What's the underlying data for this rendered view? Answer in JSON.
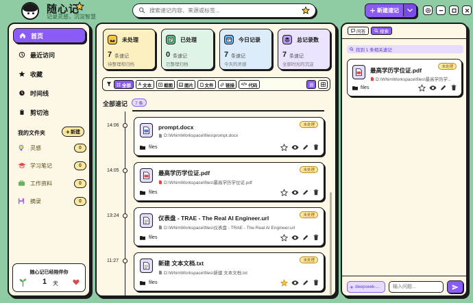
{
  "app": {
    "title": "随心记",
    "subtitle": "记录灵感，沉淀智慧"
  },
  "search": {
    "placeholder": "搜索速记内容、来源或标签..."
  },
  "toolbar": {
    "new_label": "新建速记"
  },
  "sidebar": {
    "nav": [
      {
        "label": "首页",
        "icon": "home-icon",
        "active": true
      },
      {
        "label": "最近访问",
        "icon": "history-icon",
        "active": false
      },
      {
        "label": "收藏",
        "icon": "star-icon",
        "active": false
      },
      {
        "label": "时间线",
        "icon": "timeline-icon",
        "active": false
      },
      {
        "label": "剪切池",
        "icon": "clipboard-icon",
        "active": false
      }
    ],
    "folders_title": "我的文件夹",
    "new_folder_label": "新建",
    "folders": [
      {
        "name": "灵感",
        "count": "0",
        "icon": "bulb-icon"
      },
      {
        "name": "学习笔记",
        "count": "0",
        "icon": "graduation-cap-icon"
      },
      {
        "name": "工作资料",
        "count": "0",
        "icon": "briefcase-icon"
      },
      {
        "name": "摘录",
        "count": "0",
        "icon": "floppy-disk-icon"
      }
    ],
    "streak": {
      "title": "随心记已经陪伴你",
      "days": "1",
      "unit": "天"
    }
  },
  "stats": [
    {
      "title": "未处理",
      "count": "7",
      "unit": "条速记",
      "desc": "待整理和归档",
      "bg": "#fdf0c0",
      "icon_bg": "#f5c542",
      "icon": "inbox-icon"
    },
    {
      "title": "已处理",
      "count": "0",
      "unit": "条速记",
      "desc": "已整理归档",
      "bg": "#dff3e6",
      "icon_bg": "#5cc489",
      "icon": "checklist-icon"
    },
    {
      "title": "今日记录",
      "count": "7",
      "unit": "条速记",
      "desc": "今天的灵感",
      "bg": "#dcecfb",
      "icon_bg": "#6cb4ef",
      "icon": "calendar-icon"
    },
    {
      "title": "总记录数",
      "count": "7",
      "unit": "条速记",
      "desc": "全部时光的沉淀",
      "bg": "#ece4ff",
      "icon_bg": "#b89cf8",
      "icon": "stack-icon"
    }
  ],
  "filters": [
    {
      "label": "全部",
      "active": true
    },
    {
      "label": "文本",
      "active": false
    },
    {
      "label": "截图",
      "active": false
    },
    {
      "label": "图片",
      "active": false
    },
    {
      "label": "文件",
      "active": false
    },
    {
      "label": "链接",
      "active": false
    },
    {
      "label": "代码",
      "active": false
    }
  ],
  "list": {
    "title": "全部速记",
    "count": "7 条"
  },
  "timeline": [
    {
      "time": "14:06",
      "title": "prompt.docx",
      "path": "D:\\WhimWorkspace\\files\\prompt.docx",
      "folder": "files",
      "badge": "未处理",
      "file_color": "#4a78d8",
      "starred": false
    },
    {
      "time": "14:05",
      "title": "最高学历学位证.pdf",
      "path": "D:\\WhimWorkspace\\files\\最高学历学位证.pdf",
      "folder": "files",
      "badge": "未处理",
      "file_color": "#e04848",
      "starred": false
    },
    {
      "time": "13:24",
      "title": "仪表盘 - TRAE - The Real AI Engineer.url",
      "path": "D:\\WhimWorkspace\\files\\仪表盘 - TRAE - The Real AI Engineer.url",
      "folder": "files",
      "badge": "未处理",
      "file_color": "#888888",
      "starred": false
    },
    {
      "time": "11:27",
      "title": "新建 文本文档.txt",
      "path": "D:\\WhimWorkspace\\files\\新建 文本文档.txt",
      "folder": "files",
      "badge": "未处理",
      "file_color": "#888888",
      "starred": true
    }
  ],
  "right": {
    "tabs": [
      {
        "label": "问答",
        "active": false
      },
      {
        "label": "搜索",
        "active": true
      }
    ],
    "found": "找到 1 条相关速记",
    "result": {
      "title": "最高学历学位证.pdf",
      "path": "D:\\WhimWorkspace\\files\\最高学历学...",
      "folder": "files",
      "badge": "未处理"
    },
    "model": "deepseek-...",
    "ask_placeholder": "输入问题..."
  },
  "colors": {
    "accent": "#8a5cf5",
    "background": "#8fcca6",
    "panel": "#fdf8e6",
    "badge": "#fde8a0"
  }
}
